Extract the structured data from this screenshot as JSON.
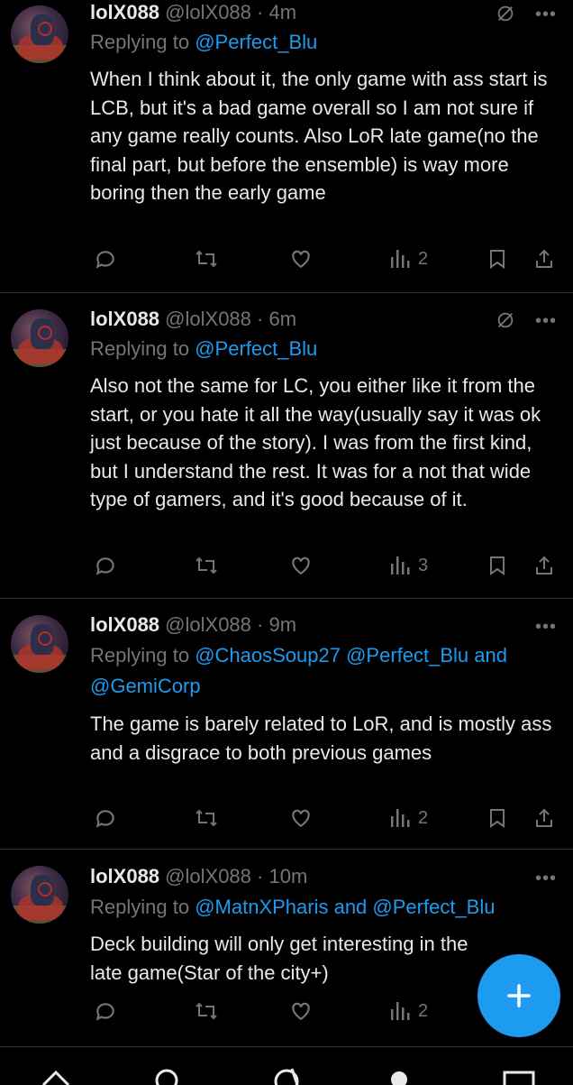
{
  "tweets": [
    {
      "name": "lolX088",
      "handle": "@lolX088",
      "time": "4m",
      "replying_prefix": "Replying to",
      "replying_to": "@Perfect_Blu",
      "text": "When I think about it, the only game with ass start is LCB, but it's a bad game overall so I am not sure if any game really counts. Also LoR late game(no the final part, but before the ensemble) is way more boring then the early game",
      "views": "2",
      "has_mute_icon": true
    },
    {
      "name": "lolX088",
      "handle": "@lolX088",
      "time": "6m",
      "replying_prefix": "Replying to",
      "replying_to": "@Perfect_Blu",
      "text": "Also not the same for LC, you either like it from the start, or you hate it all the way(usually say it was ok just because of the story). I was from the first kind, but I understand the rest. It was for a not that wide type of gamers, and it's good because of it.",
      "views": "3",
      "has_mute_icon": true
    },
    {
      "name": "lolX088",
      "handle": "@lolX088",
      "time": "9m",
      "replying_prefix": "Replying to",
      "replying_to_line1": "@ChaosSoup27 @Perfect_Blu and",
      "replying_to_line2": "@GemiCorp",
      "text": "The game is barely related to LoR, and is mostly ass and a disgrace to both previous games",
      "views": "2",
      "has_mute_icon": false
    },
    {
      "name": "lolX088",
      "handle": "@lolX088",
      "time": "10m",
      "replying_prefix": "Replying to",
      "replying_to": "@MatnXPharis and @Perfect_Blu",
      "text": "Deck building will only get interesting in the late game(Star of the city+)",
      "views": "2",
      "has_mute_icon": false
    }
  ],
  "compose_button": {
    "icon": "plus-icon"
  },
  "colors": {
    "background": "#000000",
    "text": "#e7e9ea",
    "muted": "#71767b",
    "accent": "#1d9bf0",
    "divider": "#2f3336"
  }
}
